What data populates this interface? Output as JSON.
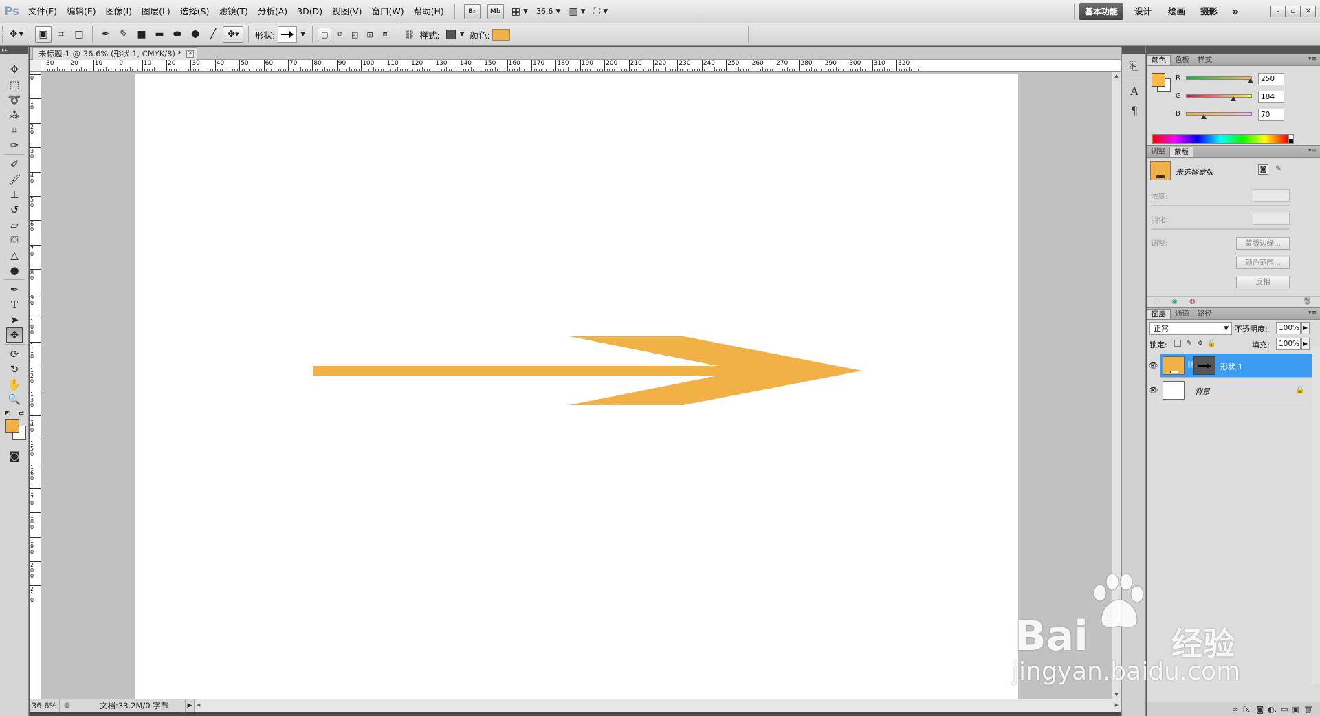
{
  "app": {
    "logo": "Ps"
  },
  "menu": [
    "文件(F)",
    "编辑(E)",
    "图像(I)",
    "图层(L)",
    "选择(S)",
    "滤镜(T)",
    "分析(A)",
    "3D(D)",
    "视图(V)",
    "窗口(W)",
    "帮助(H)"
  ],
  "menubar_buttons": {
    "bridge": "Br",
    "mini_bridge": "Mb",
    "zoom": "36.6"
  },
  "workspaces": {
    "active": "基本功能",
    "others": [
      "设计",
      "绘画",
      "摄影"
    ],
    "more": "»"
  },
  "window_controls": [
    "–",
    "▫",
    "✕"
  ],
  "options": {
    "shape_label": "形状:",
    "style_label": "样式:",
    "color_label": "颜色:",
    "color": "#f2b146"
  },
  "document": {
    "tab_title": "未标题-1 @ 36.6% (形状 1, CMYK/8) *",
    "ruler_h": [
      "30",
      "20",
      "10",
      "0",
      "10",
      "20",
      "30",
      "40",
      "50",
      "60",
      "70",
      "80",
      "90",
      "100",
      "110",
      "120",
      "130",
      "140",
      "150",
      "160",
      "170",
      "180",
      "190",
      "200",
      "210",
      "220",
      "230",
      "240",
      "250",
      "260",
      "270",
      "280",
      "290",
      "300",
      "310",
      "320"
    ],
    "ruler_v": [
      "0",
      "1 0",
      "2 0",
      "3 0",
      "4 0",
      "5 0",
      "6 0",
      "7 0",
      "8 0",
      "9 0",
      "1 0 0",
      "1 1 0",
      "1 2 0",
      "1 3 0",
      "1 4 0",
      "1 5 0",
      "1 6 0",
      "1 7 0",
      "1 8 0",
      "1 9 0",
      "2 0 0",
      "2 1 0"
    ],
    "arrow_color": "#f2b146"
  },
  "status": {
    "zoom": "36.6%",
    "doc_info": "文档:33.2M/0 字节"
  },
  "color_panel": {
    "tabs": [
      "颜色",
      "色板",
      "样式"
    ],
    "fg_color": "#fab846",
    "channels": [
      {
        "name": "R",
        "value": "250",
        "frac": 0.98
      },
      {
        "name": "G",
        "value": "184",
        "frac": 0.72
      },
      {
        "name": "B",
        "value": "70",
        "frac": 0.27
      }
    ]
  },
  "masks_panel": {
    "tabs": [
      "调整",
      "蒙版"
    ],
    "title": "未选择蒙版",
    "density_label": "浓度:",
    "feather_label": "羽化:",
    "refine_label": "调整:",
    "buttons": [
      "蒙版边缘...",
      "颜色范围...",
      "反相"
    ]
  },
  "layers_panel": {
    "tabs": [
      "图层",
      "通道",
      "路径"
    ],
    "blend_mode": "正常",
    "opacity_label": "不透明度:",
    "opacity": "100%",
    "lock_label": "锁定:",
    "fill_label": "填充:",
    "fill": "100%",
    "layers": [
      {
        "name": "形状 1",
        "selected": true,
        "thumb": "#f2b146"
      },
      {
        "name": "背景",
        "selected": false,
        "thumb": "#ffffff"
      }
    ],
    "footer_icons": [
      "∞",
      "fx.",
      "◙",
      "◐.",
      "▭",
      "▣",
      "🗑"
    ]
  },
  "watermark": {
    "brand": "Bai",
    "brand2": "经验",
    "url": "jingyan.baidu.com"
  }
}
